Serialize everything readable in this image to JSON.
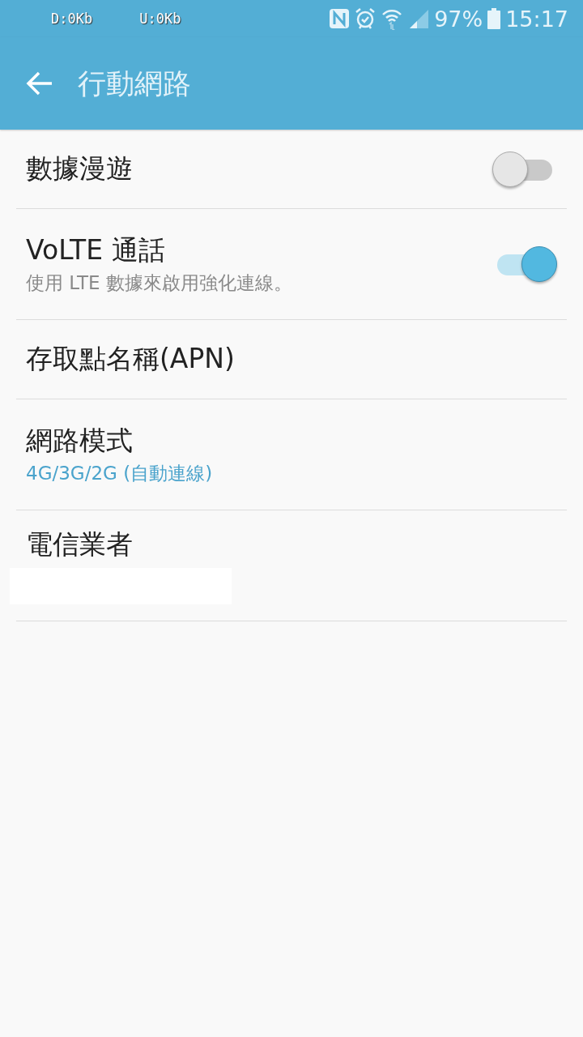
{
  "status_bar": {
    "download": "D:0Kb",
    "upload": "U:0Kb",
    "battery": "97%",
    "time": "15:17"
  },
  "app_bar": {
    "title": "行動網路"
  },
  "items": [
    {
      "kind": "switch",
      "title": "數據漫遊",
      "on": false
    },
    {
      "kind": "switch",
      "title": "VoLTE 通話",
      "summary": "使用 LTE 數據來啟用強化連線。",
      "summary_accent": false,
      "on": true
    },
    {
      "kind": "plain",
      "title": "存取點名稱(APN)"
    },
    {
      "kind": "plain",
      "title": "網路模式",
      "summary": "4G/3G/2G (自動連線)",
      "summary_accent": true
    },
    {
      "kind": "plain",
      "title": "電信業者",
      "redacted": true
    }
  ]
}
